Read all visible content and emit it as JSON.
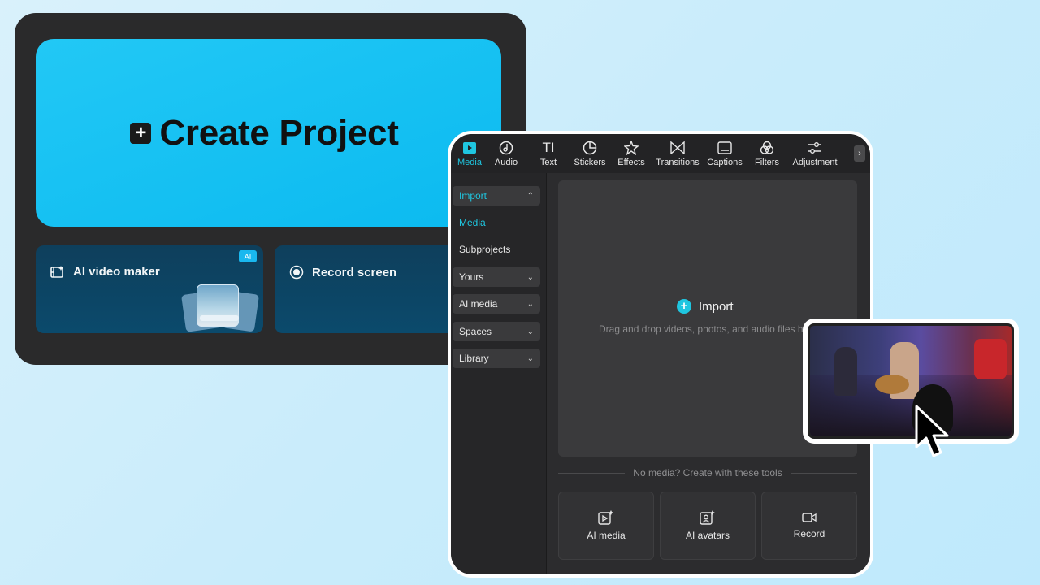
{
  "back_card": {
    "create_title": "Create Project",
    "tools": [
      {
        "label": "AI video maker",
        "badge": "AI"
      },
      {
        "label": "Record screen"
      }
    ]
  },
  "editor": {
    "tabs": [
      {
        "label": "Media",
        "icon": "media-icon",
        "active": true
      },
      {
        "label": "Audio",
        "icon": "audio-icon"
      },
      {
        "label": "Text",
        "icon": "text-icon"
      },
      {
        "label": "Stickers",
        "icon": "stickers-icon"
      },
      {
        "label": "Effects",
        "icon": "effects-icon"
      },
      {
        "label": "Transitions",
        "icon": "transitions-icon"
      },
      {
        "label": "Captions",
        "icon": "captions-icon"
      },
      {
        "label": "Filters",
        "icon": "filters-icon"
      },
      {
        "label": "Adjustment",
        "icon": "adjustment-icon"
      }
    ],
    "sidebar": [
      {
        "label": "Import"
      },
      {
        "label": "Media"
      },
      {
        "label": "Subprojects"
      },
      {
        "label": "Yours"
      },
      {
        "label": "AI media"
      },
      {
        "label": "Spaces"
      },
      {
        "label": "Library"
      }
    ],
    "import_label": "Import",
    "import_hint": "Drag and drop videos, photos, and audio files here",
    "divider_text": "No media? Create with these tools",
    "create_tools": [
      {
        "label": "AI media",
        "icon": "ai-media-icon"
      },
      {
        "label": "AI avatars",
        "icon": "ai-avatars-icon"
      },
      {
        "label": "Record",
        "icon": "record-icon"
      }
    ]
  },
  "colors": {
    "accent": "#1fc6e0",
    "create_tile": "#0bbaf0",
    "panel_bg": "#2c2c2e"
  }
}
